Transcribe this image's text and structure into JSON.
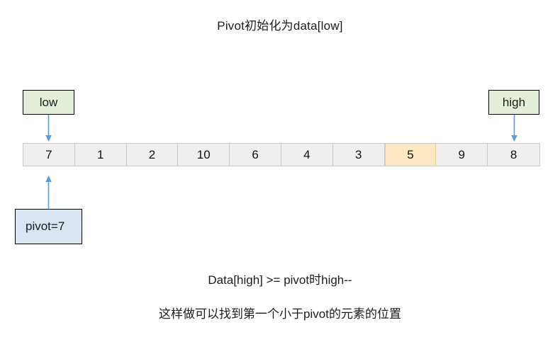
{
  "title": "Pivot初始化为data[low]",
  "pointers": {
    "low": {
      "label": "low",
      "fill": "#e3efda"
    },
    "high": {
      "label": "high",
      "fill": "#e3efda"
    },
    "pivot": {
      "label": "pivot=7",
      "fill": "#dbe5f1"
    }
  },
  "arrows": {
    "color": "#5b9bd5",
    "low_arrow": "down-arrow",
    "high_arrow": "down-arrow",
    "pivot_arrow": "up-arrow"
  },
  "array": {
    "cells": [
      {
        "value": "7",
        "highlight": false
      },
      {
        "value": "1",
        "highlight": false
      },
      {
        "value": "2",
        "highlight": false
      },
      {
        "value": "10",
        "highlight": false
      },
      {
        "value": "6",
        "highlight": false
      },
      {
        "value": "4",
        "highlight": false
      },
      {
        "value": "3",
        "highlight": false
      },
      {
        "value": "5",
        "highlight": true
      },
      {
        "value": "9",
        "highlight": false
      },
      {
        "value": "8",
        "highlight": false
      }
    ],
    "cell_fill": "#efefef",
    "highlight_fill": "#fdeac4"
  },
  "captions": {
    "line1": "Data[high] >= pivot时high--",
    "line2": "这样做可以找到第一个小于pivot的元素的位置"
  }
}
